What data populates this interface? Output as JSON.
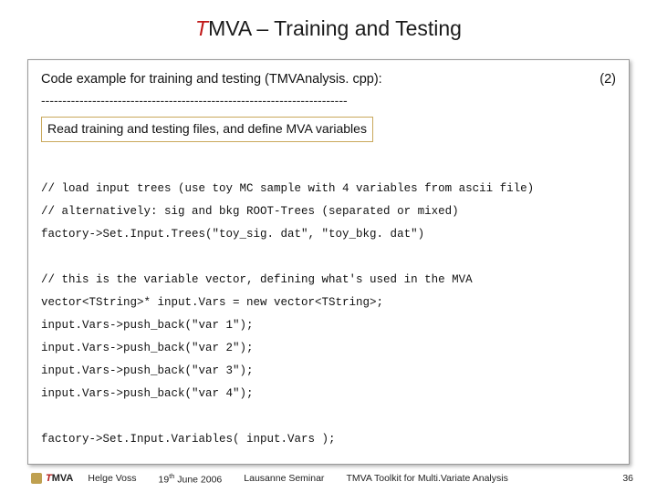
{
  "title": {
    "t": "T",
    "rest": "MVA – Training and Testing"
  },
  "header": {
    "caption": "Code example for training and testing (TMVAnalysis. cpp):",
    "page_marker": "(2)"
  },
  "dashes": "------------------------------------------------------------------------",
  "subtitle": "Read training and testing files, and define MVA variables",
  "code": {
    "l1": "// load input trees (use toy MC sample with 4 variables from ascii file)",
    "l2": "// alternatively: sig and bkg ROOT-Trees (separated or mixed)",
    "l3": "factory->Set.Input.Trees(\"toy_sig. dat\", \"toy_bkg. dat\")",
    "l4": "// this is the variable vector, defining what's used in the MVA",
    "l5": "vector<TString>* input.Vars = new vector<TString>;",
    "l6": "input.Vars->push_back(\"var 1\");",
    "l7": "input.Vars->push_back(\"var 2\");",
    "l8": "input.Vars->push_back(\"var 3\");",
    "l9": "input.Vars->push_back(\"var 4\");",
    "l10": "factory->Set.Input.Variables( input.Vars );"
  },
  "footer": {
    "logo_t": "T",
    "logo_mva": "MVA",
    "author": "Helge Voss",
    "date_pre": "19",
    "date_sup": "th",
    "date_post": " June 2006",
    "venue": "Lausanne Seminar",
    "desc": "TMVA Toolkit for Multi.Variate Analysis",
    "pagenum": "36"
  }
}
